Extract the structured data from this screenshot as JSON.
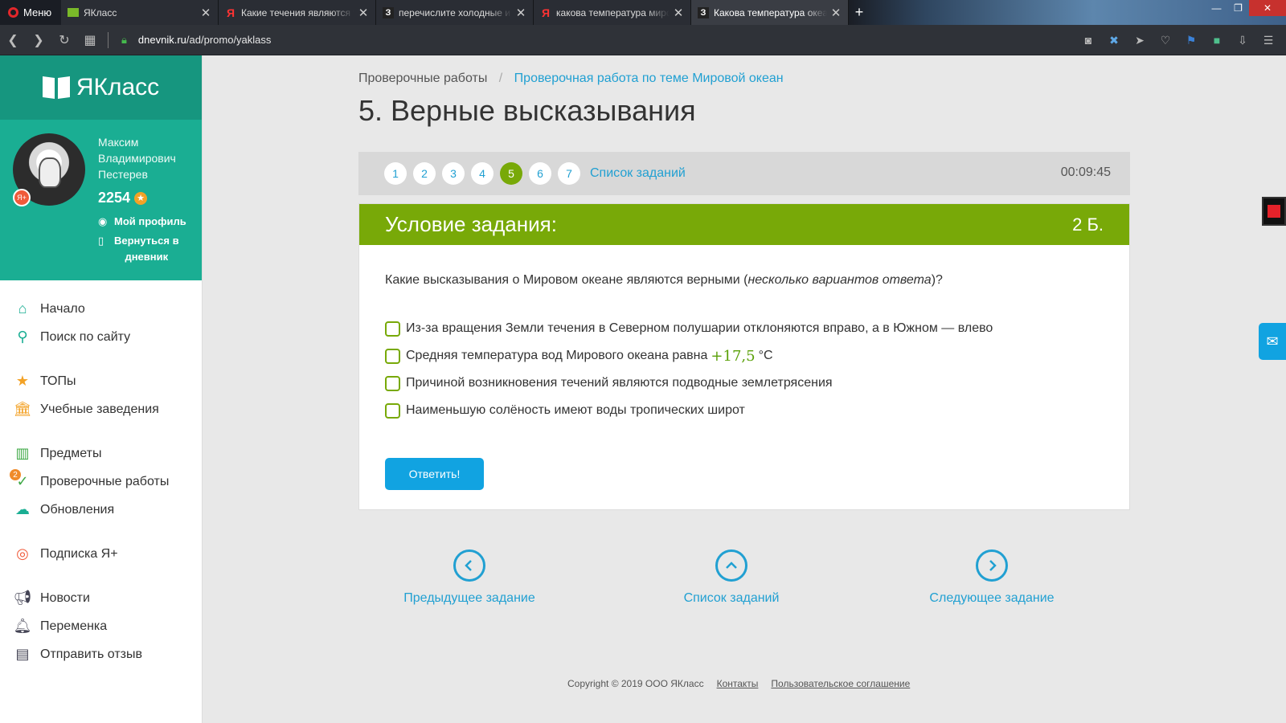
{
  "browser": {
    "menu_label": "Меню",
    "tabs": [
      {
        "title": "ЯКласс",
        "favicon": "yaklass-book-icon",
        "active": false
      },
      {
        "title": "Какие течения являются т",
        "favicon": "yandex-icon",
        "active": false
      },
      {
        "title": "перечислите холодные и",
        "favicon": "z-icon",
        "active": false
      },
      {
        "title": "какова температура миро",
        "favicon": "yandex-icon",
        "active": false
      },
      {
        "title": "Какова температура океа",
        "favicon": "z-icon",
        "active": true
      }
    ],
    "url_domain": "dnevnik.ru",
    "url_path": "/ad/promo/yaklass"
  },
  "sidebar": {
    "logo_text": "ЯКласс",
    "user": {
      "first_name": "Максим",
      "middle_name": "Владимирович",
      "last_name": "Пестерев",
      "points": "2254"
    },
    "profile_link": "Мой профиль",
    "back_link_1": "Вернуться в",
    "back_link_2": "дневник",
    "menu": {
      "home": "Начало",
      "search": "Поиск по сайту",
      "tops": "ТОПы",
      "schools": "Учебные заведения",
      "subjects": "Предметы",
      "tests": "Проверочные работы",
      "tests_badge": "2",
      "updates": "Обновления",
      "subscription": "Подписка Я+",
      "news": "Новости",
      "break": "Переменка",
      "feedback": "Отправить отзыв"
    }
  },
  "main": {
    "breadcrumb_root": "Проверочные работы",
    "breadcrumb_current": "Проверочная работа по теме Мировой океан",
    "title": "5. Верные высказывания",
    "questions": [
      "1",
      "2",
      "3",
      "4",
      "5",
      "6",
      "7"
    ],
    "current_question": "5",
    "task_list_label": "Список заданий",
    "timer": "00:09:45",
    "card": {
      "header": "Условие задания:",
      "score": "2 Б.",
      "question_pre": "Какие высказывания о Мировом океане являются верными (",
      "question_em": "несколько вариантов ответа",
      "question_post": ")?",
      "option1": "Из-за вращения Земли течения в Северном полушарии отклоняются вправо, а в Южном — влево",
      "option2_pre": "Средняя температура вод Мирового океана равна",
      "option2_math": "+17,5",
      "option2_post": "°C",
      "option3": "Причиной возникновения течений являются подводные землетрясения",
      "option4": "Наименьшую солёность имеют воды тропических широт",
      "answer_button": "Ответить!"
    },
    "nav_prev": "Предыдущее задание",
    "nav_list": "Список заданий",
    "nav_next": "Следующее задание"
  },
  "footer": {
    "copyright": "Copyright © 2019 ООО ЯКласс",
    "contacts": "Контакты",
    "agreement": "Пользовательское соглашение"
  },
  "colors": {
    "brand_teal": "#16967f",
    "accent_green": "#78a908",
    "link_blue": "#21a0d2",
    "button_blue": "#11a3e1"
  }
}
